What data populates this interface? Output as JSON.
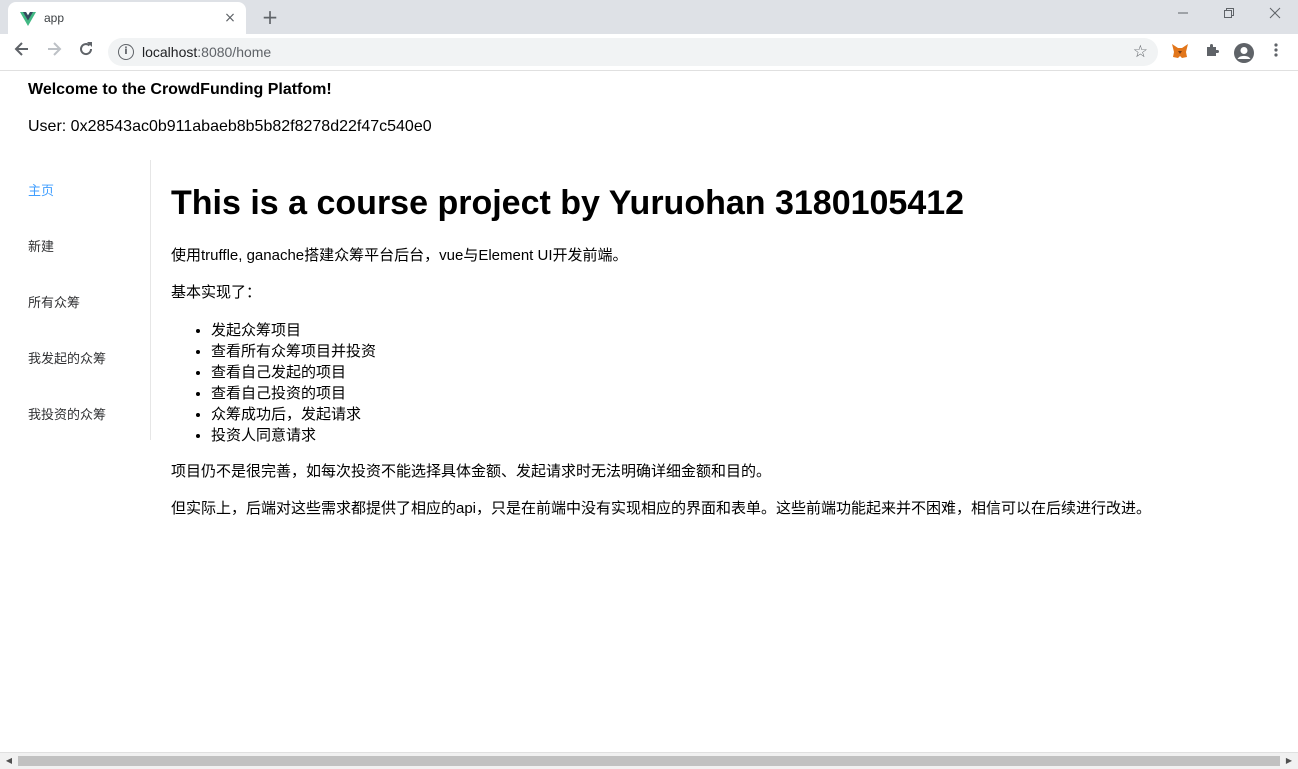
{
  "browser": {
    "tab_title": "app",
    "url_host": "localhost",
    "url_rest": ":8080/home",
    "new_tab": "+",
    "close_tab": "×"
  },
  "header": {
    "welcome": "Welcome to the CrowdFunding Platfom!",
    "user": "User: 0x28543ac0b911abaeb8b5b82f8278d22f47c540e0"
  },
  "sidebar": {
    "items": [
      {
        "label": "主页",
        "active": true
      },
      {
        "label": "新建",
        "active": false
      },
      {
        "label": "所有众筹",
        "active": false
      },
      {
        "label": "我发起的众筹",
        "active": false
      },
      {
        "label": "我投资的众筹",
        "active": false
      }
    ]
  },
  "main": {
    "title": "This is a course project by Yuruohan 3180105412",
    "intro": "使用truffle, ganache搭建众筹平台后台，vue与Element UI开发前端。",
    "basic": "基本实现了：",
    "features": [
      "发起众筹项目",
      "查看所有众筹项目并投资",
      "查看自己发起的项目",
      "查看自己投资的项目",
      "众筹成功后，发起请求",
      "投资人同意请求"
    ],
    "note1": "项目仍不是很完善，如每次投资不能选择具体金额、发起请求时无法明确详细金额和目的。",
    "note2": "但实际上，后端对这些需求都提供了相应的api，只是在前端中没有实现相应的界面和表单。这些前端功能起来并不困难，相信可以在后续进行改进。"
  },
  "colors": {
    "active_menu": "#409eff",
    "vue_green": "#41b883",
    "vue_dark": "#35495e"
  }
}
